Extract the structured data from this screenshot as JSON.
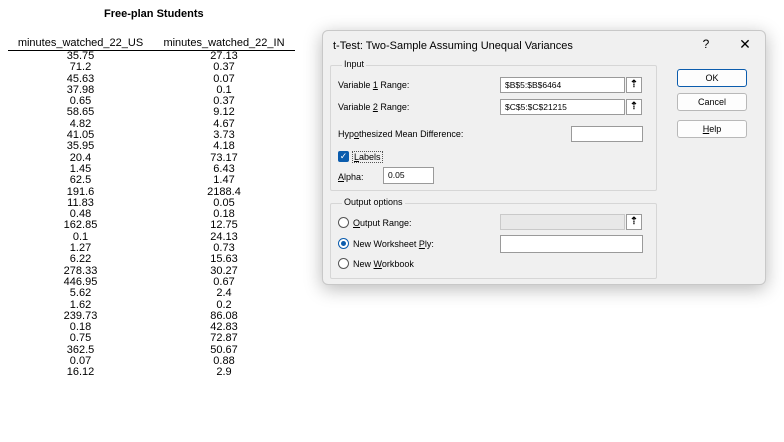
{
  "sheet": {
    "title": "Free-plan Students",
    "columns": [
      "minutes_watched_22_US",
      "minutes_watched_22_IN"
    ],
    "rows": [
      [
        "35.75",
        "27.13"
      ],
      [
        "71.2",
        "0.37"
      ],
      [
        "45.63",
        "0.07"
      ],
      [
        "37.98",
        "0.1"
      ],
      [
        "0.65",
        "0.37"
      ],
      [
        "58.65",
        "9.12"
      ],
      [
        "4.82",
        "4.67"
      ],
      [
        "41.05",
        "3.73"
      ],
      [
        "35.95",
        "4.18"
      ],
      [
        "20.4",
        "73.17"
      ],
      [
        "1.45",
        "6.43"
      ],
      [
        "62.5",
        "1.47"
      ],
      [
        "191.6",
        "2188.4"
      ],
      [
        "11.83",
        "0.05"
      ],
      [
        "0.48",
        "0.18"
      ],
      [
        "162.85",
        "12.75"
      ],
      [
        "0.1",
        "24.13"
      ],
      [
        "1.27",
        "0.73"
      ],
      [
        "6.22",
        "15.63"
      ],
      [
        "278.33",
        "30.27"
      ],
      [
        "446.95",
        "0.67"
      ],
      [
        "5.62",
        "2.4"
      ],
      [
        "1.62",
        "0.2"
      ],
      [
        "239.73",
        "86.08"
      ],
      [
        "0.18",
        "42.83"
      ],
      [
        "0.75",
        "72.87"
      ],
      [
        "362.5",
        "50.67"
      ],
      [
        "0.07",
        "0.88"
      ],
      [
        "16.12",
        "2.9"
      ]
    ]
  },
  "dialog": {
    "title": "t-Test: Two-Sample Assuming Unequal Variances",
    "help_glyph": "?",
    "close_glyph": "✕",
    "input_group": "Input",
    "var1_label": "Variable 1 Range:",
    "var1_value": "$B$5:$B$6464",
    "var2_label": "Variable 2 Range:",
    "var2_value": "$C$5:$C$21215",
    "hyp_label": "Hypothesized Mean Difference:",
    "hyp_value": "",
    "labels_label": "Labels",
    "labels_checked": true,
    "alpha_label": "Alpha:",
    "alpha_value": "0.05",
    "output_group": "Output options",
    "output_range_label": "Output Range:",
    "output_range_value": "",
    "new_ply_label": "New Worksheet Ply:",
    "new_ply_value": "",
    "new_workbook_label": "New Workbook",
    "selected_output": "New Worksheet Ply",
    "ok_label": "OK",
    "cancel_label": "Cancel",
    "help_label": "Help",
    "accent_color": "#0b5cad"
  }
}
